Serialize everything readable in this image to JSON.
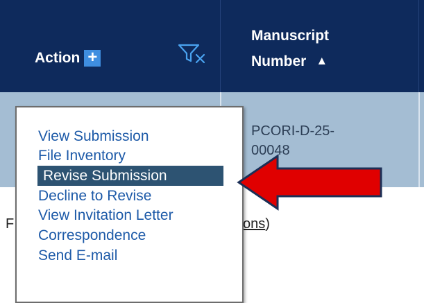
{
  "header": {
    "action_label": "Action",
    "action_add_icon": "+",
    "filter_icon": "clear-filter-icon",
    "manuscript_number_line1": "Manuscript",
    "manuscript_number_line2": "Number",
    "sort_icon": "▲"
  },
  "row": {
    "manuscript_number_line1": "PCORI-D-25-",
    "manuscript_number_line2": "00048"
  },
  "action_menu": {
    "items": [
      {
        "label": "View Submission"
      },
      {
        "label": "File Inventory"
      },
      {
        "label": "Revise Submission",
        "highlighted": true
      },
      {
        "label": "Decline to Revise"
      },
      {
        "label": "View Invitation Letter"
      },
      {
        "label": "Correspondence"
      },
      {
        "label": "Send E-mail"
      }
    ]
  },
  "below_table": {
    "left_fragment": "F",
    "right_fragment_link": "ons",
    "right_fragment_tail": ")"
  },
  "annotation": {
    "arrow": "red-arrow-pointing-left",
    "arrow_color": "#e00000",
    "arrow_outline": "#1b2f56"
  },
  "colors": {
    "header_bg": "#0e2a5c",
    "row_bg": "#a4bdd3",
    "menu_link": "#1d5aa8",
    "menu_highlight": "#2d5372"
  }
}
